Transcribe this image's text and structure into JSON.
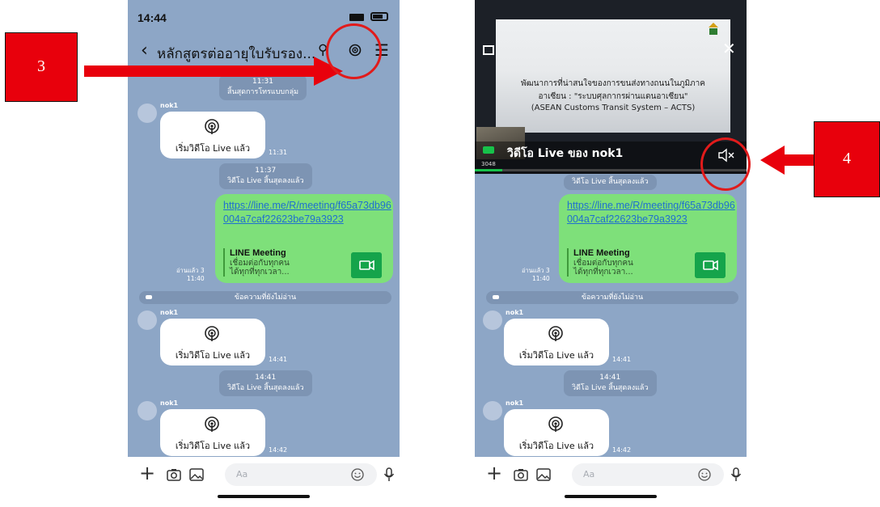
{
  "callouts": {
    "step_left": "3",
    "step_right": "4"
  },
  "phone_left": {
    "status_time": "14:44",
    "chat_title": "หลักสูตรต่ออายุใบรับรอง...",
    "pill_1_time": "11:31",
    "pill_1_text": "สิ้นสุดการโทรแบบกลุ่ม",
    "sender_1": "nok1",
    "live_1_text": "เริ่มวิดีโอ Live แล้ว",
    "live_1_time": "11:31",
    "pill_2_time": "11:37",
    "pill_2_text": "วิดีโอ Live สิ้นสุดลงแล้ว",
    "link_url": "https://line.me/R/meeting/f65a73db96004a7caf22623be79a3923",
    "link_title": "LINE Meeting",
    "link_desc_1": "เชื่อมต่อกับทุกคน",
    "link_desc_2": "ได้ทุกที่ทุกเวลา...",
    "read_label": "อ่านแล้ว 3",
    "read_time": "11:40",
    "unread_text": "ข้อความที่ยังไม่อ่าน",
    "sender_2": "nok1",
    "live_2_text": "เริ่มวิดีโอ Live แล้ว",
    "live_2_time": "14:41",
    "pill_3_time": "14:41",
    "pill_3_text": "วิดีโอ Live สิ้นสุดลงแล้ว",
    "sender_3": "nok1",
    "live_3_text": "เริ่มวิดีโอ Live แล้ว",
    "live_3_time": "14:42",
    "input_placeholder": "Aa"
  },
  "phone_right": {
    "slide_line_1": "พัฒนาการที่น่าสนใจของการขนส่งทางถนนในภูมิภาค",
    "slide_line_2": "อาเซียน : \"ระบบศุลกากรผ่านแดนอาเซียน\"",
    "slide_line_3": "(ASEAN Customs Transit System – ACTS)",
    "video_title": "วิดีโอ Live ของ nok1",
    "video_sub": "3048",
    "pill_top_text": "วิดีโอ Live สิ้นสุดลงแล้ว",
    "link_url": "https://line.me/R/meeting/f65a73db96004a7caf22623be79a3923",
    "link_title": "LINE Meeting",
    "link_desc_1": "เชื่อมต่อกับทุกคน",
    "link_desc_2": "ได้ทุกที่ทุกเวลา...",
    "read_label": "อ่านแล้ว 3",
    "read_time": "11:40",
    "unread_text": "ข้อความที่ยังไม่อ่าน",
    "sender_2": "nok1",
    "live_2_text": "เริ่มวิดีโอ Live แล้ว",
    "live_2_time": "14:41",
    "pill_3_time": "14:41",
    "pill_3_text": "วิดีโอ Live สิ้นสุดลงแล้ว",
    "sender_3": "nok1",
    "live_3_text": "เริ่มวิดีโอ Live แล้ว",
    "live_3_time": "14:42",
    "input_placeholder": "Aa"
  },
  "colors": {
    "chat_bg": "#8da6c6",
    "link_bubble": "#7ee07a",
    "accent_red": "#e8000c",
    "line_green": "#15a44b"
  },
  "icons": [
    "back-icon",
    "search-icon",
    "live-broadcast-icon",
    "menu-icon",
    "plus-icon",
    "camera-icon",
    "image-icon",
    "emoji-icon",
    "mic-icon",
    "video-call-icon",
    "mute-icon",
    "close-icon"
  ]
}
